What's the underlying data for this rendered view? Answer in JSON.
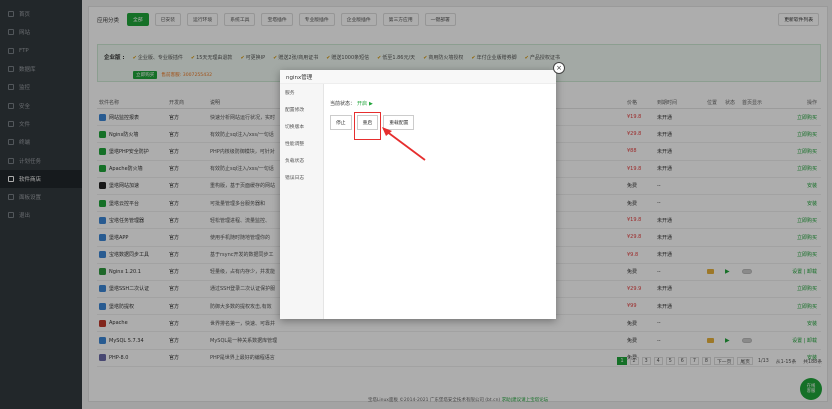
{
  "sidebar": {
    "items": [
      {
        "label": "首页",
        "icon": "home-icon"
      },
      {
        "label": "网站",
        "icon": "globe-icon"
      },
      {
        "label": "FTP",
        "icon": "ftp-icon"
      },
      {
        "label": "数据库",
        "icon": "database-icon"
      },
      {
        "label": "监控",
        "icon": "monitor-icon"
      },
      {
        "label": "安全",
        "icon": "shield-icon"
      },
      {
        "label": "文件",
        "icon": "folder-icon"
      },
      {
        "label": "终端",
        "icon": "terminal-icon"
      },
      {
        "label": "计划任务",
        "icon": "clock-icon"
      },
      {
        "label": "软件商店",
        "icon": "grid-icon"
      },
      {
        "label": "面板设置",
        "icon": "gear-icon"
      },
      {
        "label": "退出",
        "icon": "logout-icon"
      }
    ],
    "active_index": 9
  },
  "toolbar": {
    "category_label": "应用分类",
    "tabs": [
      "全部",
      "已安装",
      "运行环境",
      "系统工具",
      "宝塔插件",
      "专业版插件",
      "企业版插件",
      "第三方应用",
      "一键部署"
    ],
    "list_button": "更新软件列表"
  },
  "banner": {
    "prefix": "企业版",
    "features": [
      "企业版、专业版插件",
      "15天无理由退款",
      "可更换IP",
      "赠送2张/商用证书",
      "赠送1000条短信",
      "低至1.86元/天",
      "商用防火墙授权",
      "年付企业版赠券脚",
      "产品授权证书"
    ],
    "buy_button": "立即购买",
    "phone": "售前客服: 3007255432"
  },
  "table": {
    "headers": [
      "软件名称",
      "开发商",
      "说明",
      "价格",
      "到期时间",
      "位置",
      "状态",
      "首页显示",
      "操作"
    ],
    "rows": [
      {
        "name": "网站监控报表",
        "dev": "官方",
        "desc": "快速分析网站运行状况，实时",
        "price": "¥19.8",
        "expire": "未开通",
        "op": "立即购买",
        "icon_color": "#3b86d6"
      },
      {
        "name": "Nginx防火墙",
        "dev": "官方",
        "desc": "有效防止sql注入/xss/一句话",
        "price": "¥29.8",
        "expire": "未开通",
        "op": "立即购买",
        "icon_color": "#20a53a"
      },
      {
        "name": "堡塔PHP安全防护",
        "dev": "官方",
        "desc": "PHP内核级防御模块，可针对",
        "price": "¥88",
        "expire": "未开通",
        "op": "立即购买",
        "icon_color": "#20a53a"
      },
      {
        "name": "Apache防火墙",
        "dev": "官方",
        "desc": "有效防止sql注入/xss/一句话",
        "price": "¥19.8",
        "expire": "未开通",
        "op": "立即购买",
        "icon_color": "#20a53a"
      },
      {
        "name": "堡塔网站加速",
        "dev": "官方",
        "desc": "重构版，基于页面缓存的网站",
        "price": "免费",
        "expire": "--",
        "op": "安装",
        "icon_color": "#222"
      },
      {
        "name": "堡塔云控平台",
        "dev": "官方",
        "desc": "可批量管理多台服务器和",
        "price": "免费",
        "expire": "--",
        "op": "安装",
        "icon_color": "#20a53a"
      },
      {
        "name": "宝塔任务管理器",
        "dev": "官方",
        "desc": "轻松管理进程、流量监控、",
        "price": "¥19.8",
        "expire": "未开通",
        "op": "立即购买",
        "icon_color": "#3b86d6"
      },
      {
        "name": "堡塔APP",
        "dev": "官方",
        "desc": "使用手机随时随地管理你的",
        "price": "¥29.8",
        "expire": "未开通",
        "op": "立即购买",
        "icon_color": "#3b86d6"
      },
      {
        "name": "宝塔数据同步工具",
        "dev": "官方",
        "desc": "基于rsync开发的数据同步工",
        "price": "¥9.8",
        "expire": "未开通",
        "op": "立即购买",
        "icon_color": "#3b86d6"
      },
      {
        "name": "Nginx 1.20.1",
        "dev": "官方",
        "desc": "轻量级，占有内存少，并发能",
        "price": "免费",
        "expire": "--",
        "op": "设置 | 卸载",
        "icon_color": "#2f9a3f",
        "installed": true
      },
      {
        "name": "堡塔SSH二次认证",
        "dev": "官方",
        "desc": "通过SSH登录二次认证保护服",
        "price": "¥29.9",
        "expire": "未开通",
        "op": "立即购买",
        "icon_color": "#3b86d6"
      },
      {
        "name": "堡塔防提权",
        "dev": "官方",
        "desc": "防御大多数的提权攻击,有效",
        "price": "¥99",
        "expire": "未开通",
        "op": "立即购买",
        "icon_color": "#3b86d6"
      },
      {
        "name": "Apache",
        "dev": "官方",
        "desc": "世界排名第一，快速、可靠并",
        "price": "免费",
        "expire": "--",
        "op": "安装",
        "icon_color": "#c0392b"
      },
      {
        "name": "MySQL 5.7.34",
        "dev": "官方",
        "desc": "MySQL是一种关系数据库管理",
        "price": "免费",
        "expire": "--",
        "op": "设置 | 卸载",
        "icon_color": "#3b86d6",
        "installed": true
      },
      {
        "name": "PHP-8.0",
        "dev": "官方",
        "desc": "PHP是世界上最好的编程语言",
        "price": "免费",
        "expire": "--",
        "op": "安装",
        "icon_color": "#6a6aa8"
      }
    ]
  },
  "pager": {
    "pages": [
      "1",
      "2",
      "3",
      "4",
      "5",
      "6",
      "7",
      "8"
    ],
    "current": "1",
    "next": "下一页",
    "last": "尾页",
    "count": "1/13",
    "range": "从1-15条",
    "total": "共188条"
  },
  "footer": {
    "text": "宝塔Linux面板 ©2014-2021 广东堡塔安全技术有限公司 (bt.cn)",
    "link": "求助|建议请上宝塔论坛"
  },
  "online_service": {
    "line1": "在线",
    "line2": "客服"
  },
  "modal": {
    "title": "nginx管理",
    "menu": [
      "服务",
      "配置修改",
      "切换版本",
      "性能调整",
      "负载状态",
      "错误日志"
    ],
    "state_label": "当前状态：",
    "state_value": "开启",
    "buttons": [
      "停止",
      "重启",
      "重载配置"
    ]
  },
  "colors": {
    "accent": "#20a53a",
    "sidebar": "#333a3f",
    "highlight": "#e62e2e"
  }
}
